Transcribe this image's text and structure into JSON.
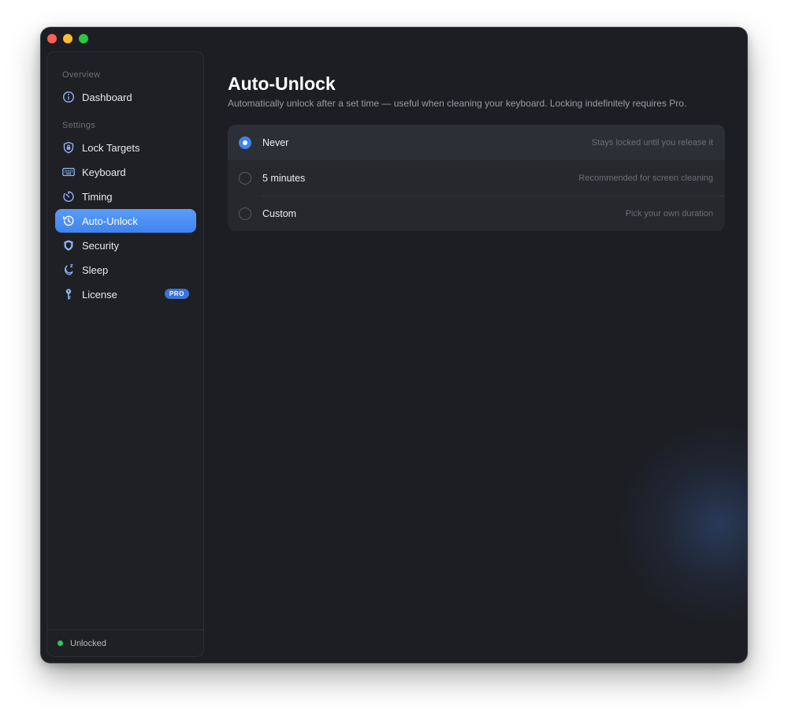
{
  "window": {
    "controls": [
      "close",
      "minimize",
      "maximize"
    ]
  },
  "sidebar": {
    "overview_label": "Overview",
    "settings_label": "Settings",
    "items": [
      {
        "label": "Dashboard",
        "icon": "info-icon",
        "active": false
      },
      {
        "label": "Lock Targets",
        "icon": "shield-lock-icon",
        "active": false
      },
      {
        "label": "Keyboard",
        "icon": "keyboard-icon",
        "active": false
      },
      {
        "label": "Timing",
        "icon": "timer-icon",
        "active": false
      },
      {
        "label": "Auto-Unlock",
        "icon": "history-icon",
        "active": true
      },
      {
        "label": "Security",
        "icon": "shield-icon",
        "active": false
      },
      {
        "label": "Sleep",
        "icon": "moon-zzz-icon",
        "active": false
      },
      {
        "label": "License",
        "icon": "key-icon",
        "active": false,
        "badge": "PRO"
      }
    ],
    "footer": {
      "status": "Unlocked",
      "status_color": "#35c759"
    }
  },
  "main": {
    "title": "Auto-Unlock",
    "subtitle": "Automatically unlock after a set time — useful when cleaning your keyboard. Locking indefinitely requires Pro.",
    "options": [
      {
        "label": "Never",
        "description": "Stays locked until you release it",
        "selected": true
      },
      {
        "label": "5 minutes",
        "description": "Recommended for screen cleaning",
        "selected": false
      },
      {
        "label": "Custom",
        "description": "Pick your own duration",
        "selected": false
      }
    ]
  },
  "colors": {
    "accent": "#3f84ef",
    "window_bg": "#1d1e23",
    "sidebar_bg": "#1f2024",
    "card_bg": "#27282d"
  }
}
